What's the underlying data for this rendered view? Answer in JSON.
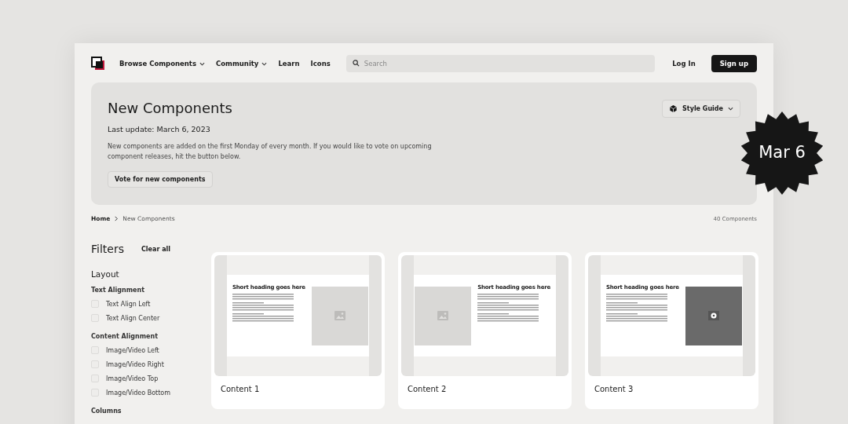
{
  "nav": {
    "links": [
      {
        "label": "Browse Components",
        "dropdown": true
      },
      {
        "label": "Community",
        "dropdown": true
      },
      {
        "label": "Learn",
        "dropdown": false
      },
      {
        "label": "Icons",
        "dropdown": false
      }
    ],
    "search": {
      "placeholder": "Search"
    },
    "login": "Log In",
    "signup": "Sign up"
  },
  "hero": {
    "title": "New Components",
    "updated": "Last update: March 6, 2023",
    "description": "New components are added on the first Monday of every month. If you would like to vote on upcoming component releases, hit the button below.",
    "button": "Vote for new components",
    "style_guide": "Style Guide"
  },
  "badge": "Mar 6",
  "breadcrumb": [
    "Home",
    "New Components"
  ],
  "count": "40 Components",
  "filters": {
    "title": "Filters",
    "clear": "Clear all",
    "section": "Layout",
    "groups": [
      {
        "title": "Text Alignment",
        "options": [
          {
            "label": "Text Align Left",
            "checked": false
          },
          {
            "label": "Text Align Center",
            "checked": false
          }
        ]
      },
      {
        "title": "Content Alignment",
        "options": [
          {
            "label": "Image/Video Left",
            "checked": false
          },
          {
            "label": "Image/Video Right",
            "checked": false
          },
          {
            "label": "Image/Video Top",
            "checked": false
          },
          {
            "label": "Image/Video Bottom",
            "checked": false
          }
        ]
      },
      {
        "title": "Columns"
      }
    ]
  },
  "cards": [
    {
      "title": "Content 1",
      "heading": "Short heading goes here",
      "kind": "image-right"
    },
    {
      "title": "Content 2",
      "heading": "Short heading goes here",
      "kind": "image-left"
    },
    {
      "title": "Content 3",
      "heading": "Short heading goes here",
      "kind": "video-right"
    }
  ]
}
